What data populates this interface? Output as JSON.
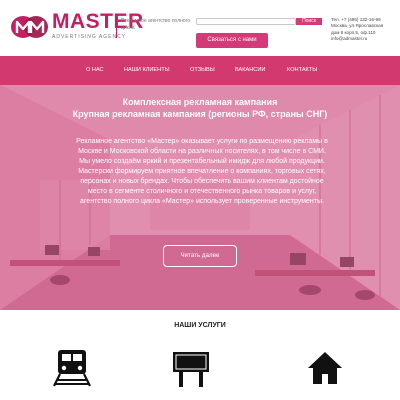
{
  "brand": {
    "name": "MASTER",
    "subtitle": "ADVERTISING AGENCY",
    "description": "Рекламное агентство полного цикла",
    "accent": "#c51f63"
  },
  "search": {
    "placeholder": "",
    "button_label": "Поиск"
  },
  "contact_button": "Связаться с нами",
  "contacts": {
    "phone": "Тел. +7 (495) 132-16-99",
    "address_line1": "Москва, ул.Ярославская",
    "address_line2": "дом 8 корп.5, оф.110",
    "email": "info@admaster.ru"
  },
  "nav": {
    "color": "#d2396f",
    "items": [
      {
        "label": "О нас"
      },
      {
        "label": "Наши клиенты"
      },
      {
        "label": "Отзывы"
      },
      {
        "label": "Вакансии"
      },
      {
        "label": "Контакты"
      }
    ]
  },
  "hero": {
    "title_line1": "Комплексная рекламная кампания",
    "title_line2": "Крупная рекламная кампания (регионы РФ, страны СНГ)",
    "text": "Рекламное агентство «Мастер» оказывает услуги по размещению рекламы в Москве и Московской области на различных носителях, в том числе в СМИ. Мы умело создаём яркий и презентабельный имидж для любой продукции. Мастерски формируем приятное впечатление о компаниях, торговых сетях, персонах и новых брендах. Чтобы обеспечить вашим клиентам достойное место в сегменте столичного и отечественного рынка товаров и услуг, агентство полного цикла «Мастер» использует проверенные инструменты.",
    "read_more": "Читать далее"
  },
  "services": {
    "title": "Наши услуги",
    "icons": [
      "train-icon",
      "billboard-icon",
      "house-icon"
    ]
  }
}
